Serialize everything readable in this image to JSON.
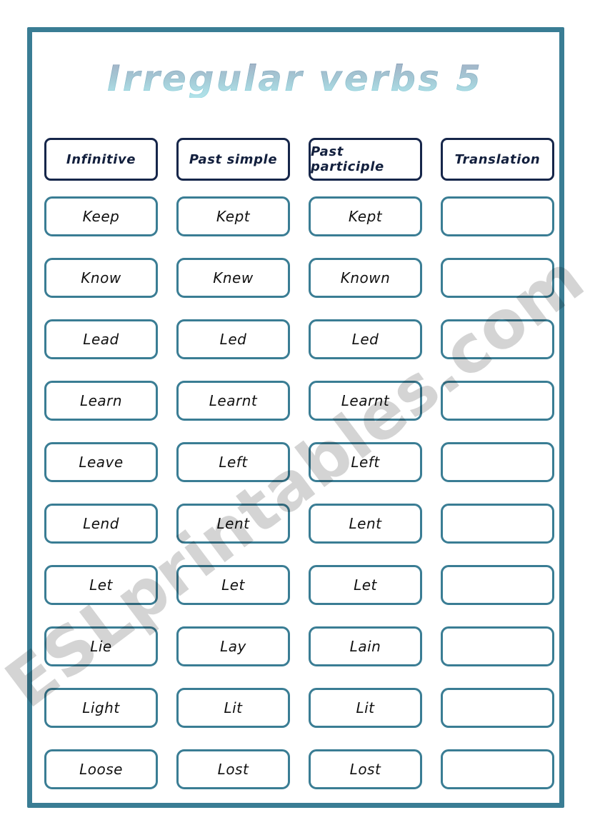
{
  "worksheet": {
    "title": "Irregular verbs 5",
    "watermark": "ESLprintables.com",
    "colors": {
      "frame": "#3a7d94",
      "cell_border": "#3a7d94",
      "header_border": "#16264a",
      "header_text": "#121f3d",
      "title_top": "#143a6b",
      "title_bottom": "#3fb9c9",
      "body_text": "#111111",
      "page_background": "#ffffff",
      "watermark": "#d5d5d5"
    },
    "table": {
      "headers": [
        "Infinitive",
        "Past simple",
        "Past participle",
        "Translation"
      ],
      "rows": [
        {
          "infinitive": "Keep",
          "past_simple": "Kept",
          "past_participle": "Kept",
          "translation": ""
        },
        {
          "infinitive": "Know",
          "past_simple": "Knew",
          "past_participle": "Known",
          "translation": ""
        },
        {
          "infinitive": "Lead",
          "past_simple": "Led",
          "past_participle": "Led",
          "translation": ""
        },
        {
          "infinitive": "Learn",
          "past_simple": "Learnt",
          "past_participle": "Learnt",
          "translation": ""
        },
        {
          "infinitive": "Leave",
          "past_simple": "Left",
          "past_participle": "Left",
          "translation": ""
        },
        {
          "infinitive": "Lend",
          "past_simple": "Lent",
          "past_participle": "Lent",
          "translation": ""
        },
        {
          "infinitive": "Let",
          "past_simple": "Let",
          "past_participle": "Let",
          "translation": ""
        },
        {
          "infinitive": "Lie",
          "past_simple": "Lay",
          "past_participle": "Lain",
          "translation": ""
        },
        {
          "infinitive": "Light",
          "past_simple": "Lit",
          "past_participle": "Lit",
          "translation": ""
        },
        {
          "infinitive": "Loose",
          "past_simple": "Lost",
          "past_participle": "Lost",
          "translation": ""
        }
      ]
    }
  }
}
